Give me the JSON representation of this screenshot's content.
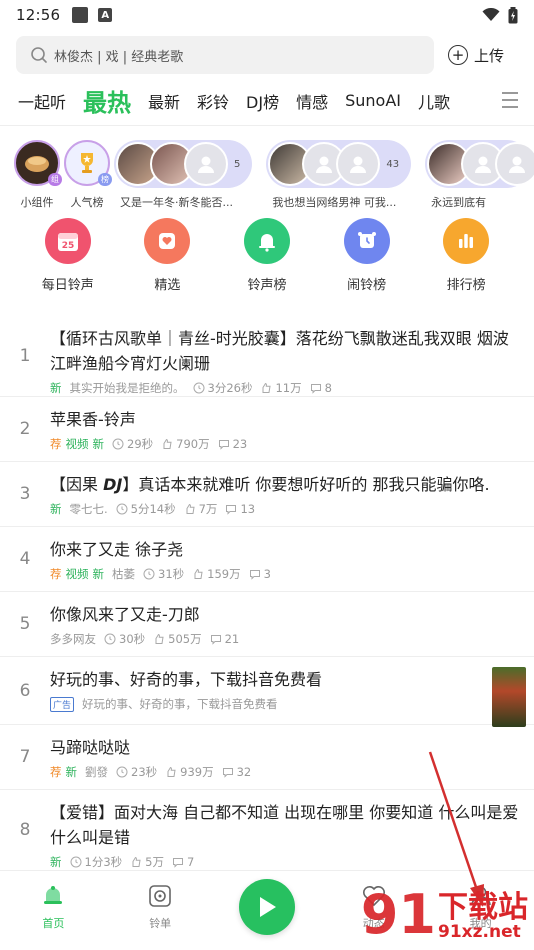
{
  "status": {
    "time": "12:56",
    "a_icon": "A"
  },
  "search": {
    "placeholder": "林俊杰 | 戏 | 经典老歌",
    "upload_label": "上传"
  },
  "tabs": [
    {
      "label": "一起听"
    },
    {
      "label": "最热",
      "active": true
    },
    {
      "label": "最新"
    },
    {
      "label": "彩铃"
    },
    {
      "label": "DJ榜"
    },
    {
      "label": "情感"
    },
    {
      "label": "SunoAI"
    },
    {
      "label": "儿歌"
    }
  ],
  "stories": {
    "widget_label": "小组件",
    "widget_badge": "组",
    "popular_label": "人气榜",
    "popular_badge": "榜",
    "group1": {
      "count": "5",
      "label": "又是一年冬·新冬能否..."
    },
    "group2": {
      "count": "43",
      "label": "我也想当网络男神 可我..."
    },
    "group3": {
      "label": "永远到底有"
    }
  },
  "quick_entries": [
    {
      "label": "每日铃声",
      "icon": "calendar-icon",
      "color": "#f0536e",
      "badge": "25"
    },
    {
      "label": "精选",
      "icon": "heart-icon",
      "color": "#f5785e"
    },
    {
      "label": "铃声榜",
      "icon": "bell-icon",
      "color": "#2fc87a"
    },
    {
      "label": "闹铃榜",
      "icon": "alarm-clock-icon",
      "color": "#6f86ef"
    },
    {
      "label": "排行榜",
      "icon": "bar-chart-icon",
      "color": "#f7a72e"
    }
  ],
  "songs": [
    {
      "num": "1",
      "title_prefix": "【循环古风歌单｜青丝-时光胶囊】落花纷飞飘散迷乱我双眼 烟波江畔渔船今宵灯火阑珊",
      "title_dj": "",
      "title_suffix": "",
      "tags": [
        "新"
      ],
      "author": "其实开始我是拒绝的。",
      "duration": "3分26秒",
      "likes": "11万",
      "comments": "8"
    },
    {
      "num": "2",
      "title_prefix": "苹果香-铃声",
      "title_dj": "",
      "title_suffix": "",
      "tags": [
        "荐",
        "视频",
        "新"
      ],
      "author": "",
      "duration": "29秒",
      "likes": "790万",
      "comments": "23"
    },
    {
      "num": "3",
      "title_prefix": "【因果 ",
      "title_dj": "DJ",
      "title_suffix": "】真话本来就难听 你要想听好听的 那我只能骗你咯.",
      "tags": [
        "新"
      ],
      "author": "零七七.",
      "duration": "5分14秒",
      "likes": "7万",
      "comments": "13"
    },
    {
      "num": "4",
      "title_prefix": "你来了又走 徐子尧",
      "title_dj": "",
      "title_suffix": "",
      "tags": [
        "荐",
        "视频",
        "新"
      ],
      "author": "枯萎",
      "duration": "31秒",
      "likes": "159万",
      "comments": "3"
    },
    {
      "num": "5",
      "title_prefix": "你像风来了又走-刀郎",
      "title_dj": "",
      "title_suffix": "",
      "tags": [],
      "author": "多多网友",
      "duration": "30秒",
      "likes": "505万",
      "comments": "21"
    },
    {
      "num": "6",
      "title_prefix": "好玩的事、好奇的事，下载抖音免费看",
      "title_dj": "",
      "title_suffix": "",
      "ad": true,
      "ad_tag": "广告",
      "ad_text": "好玩的事、好奇的事，下载抖音免费看"
    },
    {
      "num": "7",
      "title_prefix": "马蹄哒哒哒",
      "title_dj": "",
      "title_suffix": "",
      "tags": [
        "荐",
        "新"
      ],
      "author": "劉發",
      "duration": "23秒",
      "likes": "939万",
      "comments": "32"
    },
    {
      "num": "8",
      "title_prefix": "【爱错】面对大海 自己都不知道 出现在哪里 你要知道 什么叫是爱 什么叫是错",
      "title_dj": "",
      "title_suffix": "",
      "tags": [
        "新"
      ],
      "author": "",
      "duration": "1分3秒",
      "likes": "5万",
      "comments": "7"
    }
  ],
  "bottom_nav": [
    {
      "label": "首页",
      "icon": "home-bell-icon",
      "active": true
    },
    {
      "label": "铃单",
      "icon": "playlist-icon"
    },
    {
      "label": "",
      "icon": "play-icon"
    },
    {
      "label": "动态",
      "icon": "heart-pulse-icon"
    },
    {
      "label": "我的",
      "icon": "profile-icon"
    }
  ],
  "watermark": {
    "glyph": "91",
    "cn": "下载站",
    "url": "91xz.net"
  },
  "colors": {
    "accent": "#2bc05b",
    "new_tag": "#2bb25a",
    "rec_tag": "#f08a2a",
    "annotation_arrow": "#d32f2f"
  }
}
